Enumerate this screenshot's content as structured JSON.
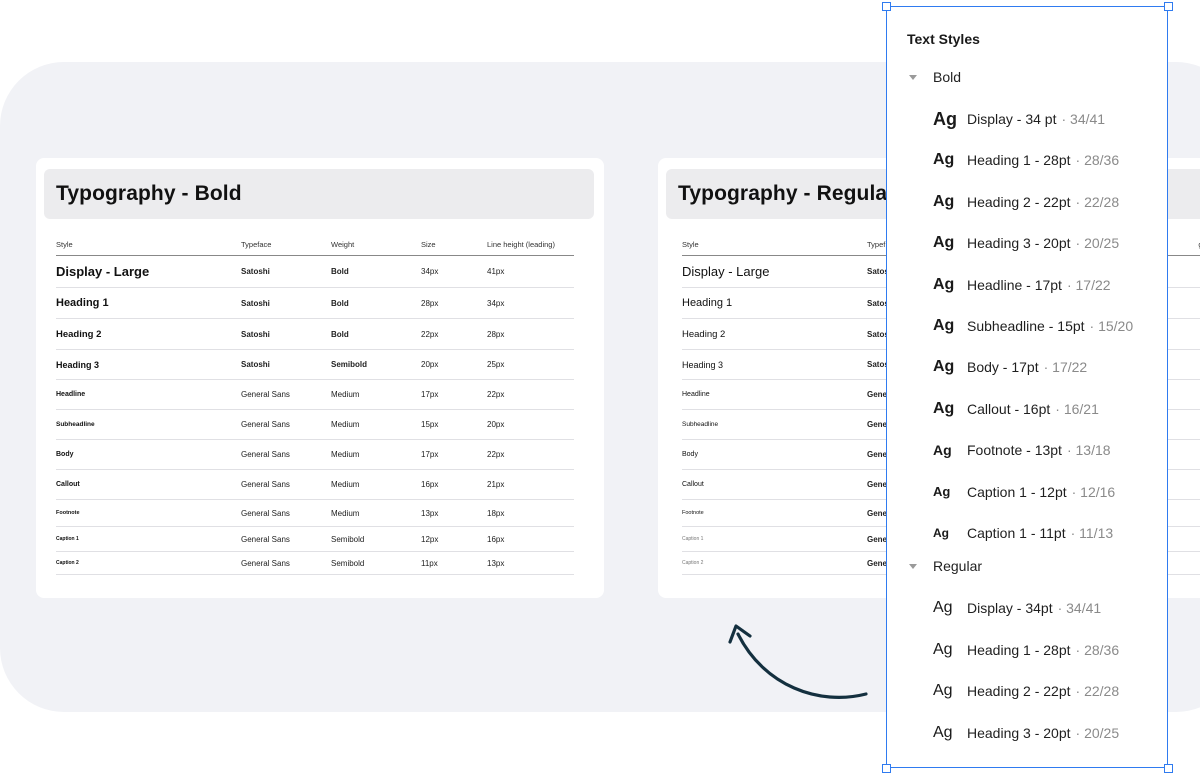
{
  "bold_card": {
    "title": "Typography - Bold",
    "columns": [
      "Style",
      "Typeface",
      "Weight",
      "Size",
      "Line height (leading)"
    ],
    "rows": [
      {
        "style": "Display - Large",
        "typeface": "Satoshi",
        "weight": "Bold",
        "size": "34px",
        "line_height": "41px"
      },
      {
        "style": "Heading 1",
        "typeface": "Satoshi",
        "weight": "Bold",
        "size": "28px",
        "line_height": "34px"
      },
      {
        "style": "Heading 2",
        "typeface": "Satoshi",
        "weight": "Bold",
        "size": "22px",
        "line_height": "28px"
      },
      {
        "style": "Heading 3",
        "typeface": "Satoshi",
        "weight": "Semibold",
        "size": "20px",
        "line_height": "25px"
      },
      {
        "style": "Headline",
        "typeface": "General Sans",
        "weight": "Medium",
        "size": "17px",
        "line_height": "22px"
      },
      {
        "style": "Subheadline",
        "typeface": "General Sans",
        "weight": "Medium",
        "size": "15px",
        "line_height": "20px"
      },
      {
        "style": "Body",
        "typeface": "General Sans",
        "weight": "Medium",
        "size": "17px",
        "line_height": "22px"
      },
      {
        "style": "Callout",
        "typeface": "General Sans",
        "weight": "Medium",
        "size": "16px",
        "line_height": "21px"
      },
      {
        "style": "Footnote",
        "typeface": "General Sans",
        "weight": "Medium",
        "size": "13px",
        "line_height": "18px"
      },
      {
        "style": "Caption 1",
        "typeface": "General Sans",
        "weight": "Semibold",
        "size": "12px",
        "line_height": "16px"
      },
      {
        "style": "Caption 2",
        "typeface": "General Sans",
        "weight": "Semibold",
        "size": "11px",
        "line_height": "13px"
      }
    ]
  },
  "regular_card": {
    "title": "Typography - Regular",
    "columns": [
      "Style",
      "Typeface",
      "",
      "",
      "Line height (leading)"
    ],
    "column_fragments": [
      "Style",
      "Typef",
      "",
      "",
      "g)"
    ],
    "rows": [
      {
        "style": "Display - Large",
        "typeface": "Satos"
      },
      {
        "style": "Heading 1",
        "typeface": "Satos"
      },
      {
        "style": "Heading 2",
        "typeface": "Satos"
      },
      {
        "style": "Heading 3",
        "typeface": "Satos"
      },
      {
        "style": "Headline",
        "typeface": "Gener"
      },
      {
        "style": "Subheadline",
        "typeface": "Gener"
      },
      {
        "style": "Body",
        "typeface": "Gener"
      },
      {
        "style": "Callout",
        "typeface": "Gener"
      },
      {
        "style": "Footnote",
        "typeface": "Gener"
      },
      {
        "style": "Caption 1",
        "typeface": "Gener"
      },
      {
        "style": "Caption 2",
        "typeface": "Gener"
      }
    ]
  },
  "panel": {
    "title": "Text Styles",
    "accent_color": "#2f7bf0",
    "groups": [
      {
        "label": "Bold",
        "items": [
          {
            "ag": "Ag",
            "name": "Display - 34 pt",
            "meta": "· 34/41"
          },
          {
            "ag": "Ag",
            "name": "Heading 1 - 28pt",
            "meta": "· 28/36"
          },
          {
            "ag": "Ag",
            "name": "Heading 2 - 22pt",
            "meta": "· 22/28"
          },
          {
            "ag": "Ag",
            "name": "Heading 3 - 20pt",
            "meta": "· 20/25"
          },
          {
            "ag": "Ag",
            "name": "Headline - 17pt",
            "meta": "· 17/22"
          },
          {
            "ag": "Ag",
            "name": "Subheadline - 15pt",
            "meta": "· 15/20"
          },
          {
            "ag": "Ag",
            "name": "Body - 17pt",
            "meta": "· 17/22"
          },
          {
            "ag": "Ag",
            "name": "Callout - 16pt",
            "meta": "· 16/21"
          },
          {
            "ag": "Ag",
            "name": "Footnote - 13pt",
            "meta": "· 13/18"
          },
          {
            "ag": "Ag",
            "name": "Caption 1 - 12pt",
            "meta": "· 12/16"
          },
          {
            "ag": "Ag",
            "name": "Caption 1 - 11pt",
            "meta": "· 11/13"
          }
        ]
      },
      {
        "label": "Regular",
        "items": [
          {
            "ag": "Ag",
            "name": "Display - 34pt",
            "meta": "· 34/41"
          },
          {
            "ag": "Ag",
            "name": "Heading 1 - 28pt",
            "meta": "· 28/36"
          },
          {
            "ag": "Ag",
            "name": "Heading 2 - 22pt",
            "meta": "· 22/28"
          },
          {
            "ag": "Ag",
            "name": "Heading 3 - 20pt",
            "meta": "· 20/25"
          }
        ]
      }
    ]
  }
}
